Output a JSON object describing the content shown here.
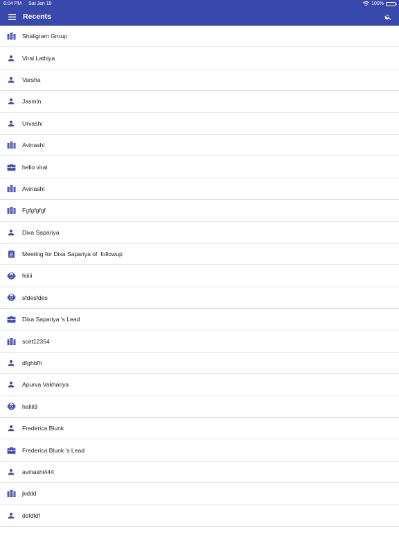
{
  "status": {
    "time": "6:04 PM",
    "date": "Sat Jan 19",
    "battery": "100%"
  },
  "appbar": {
    "title": "Recents"
  },
  "colors": {
    "primary": "#3949ab",
    "icon": "#3f51b5"
  },
  "items": [
    {
      "label": "Shaligram Group",
      "icon": "building"
    },
    {
      "label": "Viral Lathiya",
      "icon": "person"
    },
    {
      "label": "Varsha",
      "icon": "person"
    },
    {
      "label": "Jasmin",
      "icon": "person"
    },
    {
      "label": "Urvashi",
      "icon": "person"
    },
    {
      "label": "Avinashi",
      "icon": "building"
    },
    {
      "label": "hello viral",
      "icon": "briefcase"
    },
    {
      "label": "Avinashi",
      "icon": "building"
    },
    {
      "label": "Fgfgfgfgf",
      "icon": "building"
    },
    {
      "label": "Dixa Sapariya",
      "icon": "person"
    },
    {
      "label": "Meeting for Dixa Sapariya of  followup",
      "icon": "clipboard"
    },
    {
      "label": "hiiiii",
      "icon": "support"
    },
    {
      "label": "sfdesfdes",
      "icon": "support"
    },
    {
      "label": "Dixa Sapariya 's Lead",
      "icon": "briefcase"
    },
    {
      "label": "scet12354",
      "icon": "building"
    },
    {
      "label": "dfghbfh",
      "icon": "person"
    },
    {
      "label": "Apurva Vakhariya",
      "icon": "person"
    },
    {
      "label": "hellli9",
      "icon": "support"
    },
    {
      "label": "Frederica Blunk",
      "icon": "person"
    },
    {
      "label": "Frederica Blunk 's Lead",
      "icon": "briefcase"
    },
    {
      "label": "avinashi444",
      "icon": "person"
    },
    {
      "label": "jkddd",
      "icon": "building"
    },
    {
      "label": "dsfdfdf",
      "icon": "person"
    }
  ]
}
